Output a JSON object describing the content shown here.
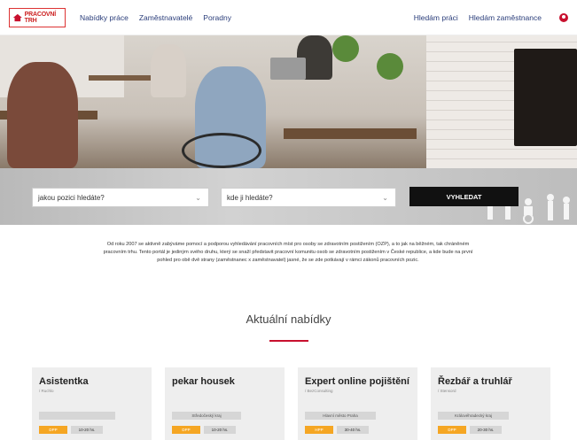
{
  "header": {
    "logo_text": "PRACOVNÍ TRH",
    "nav": [
      "Nabídky práce",
      "Zaměstnavatelé",
      "Poradny"
    ],
    "nav_right": [
      "Hledám práci",
      "Hledám zaměstnance"
    ]
  },
  "search": {
    "position_placeholder": "jakou pozici hledáte?",
    "location_placeholder": "kde ji hledáte?",
    "button_label": "VYHLEDAT"
  },
  "intro": {
    "text": "Od roku 2007 se aktivně zabýváme pomocí a podporou vyhledávání pracovních míst pro osoby se zdravotním postižením (OZP), a to jak na běžném, tak chráněném pracovním trhu. Tento portál je jediným svého druhu, který se snaží představit pracovní komunitu osob se zdravotním postižením v České republice, a kde bude na první pohled pro obě dvě strany (zaměstnanec x zaměstnavatel) jasné, že se zde potkávají v rámci zákonů pracovních pozic."
  },
  "section_title": "Aktuální nabídky",
  "cards": [
    {
      "title": "Asistentka",
      "company": "/ Ruchlo",
      "region": "",
      "type": "DPP",
      "hours": "10-20 hs."
    },
    {
      "title": "pekar housek",
      "company": "",
      "region": "Středočeský kraj",
      "type": "DPP",
      "hours": "10-20 hs."
    },
    {
      "title": "Expert online pojištění",
      "company": "/ BezConsulting",
      "region": "Hlavní město Praha",
      "type": "HPP",
      "hours": "30-40 hs."
    },
    {
      "title": "Řezbář a truhlář",
      "company": "/ Stensord",
      "region": "Královéhradecký kraj",
      "type": "DPP",
      "hours": "20-30 hs."
    }
  ]
}
